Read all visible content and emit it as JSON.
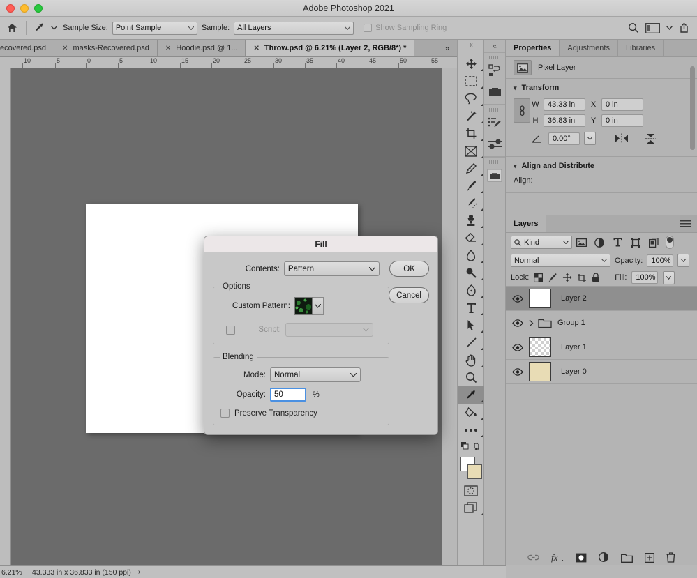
{
  "window": {
    "title": "Adobe Photoshop 2021",
    "traffic_lights": [
      "close",
      "minimize",
      "zoom"
    ]
  },
  "options_bar": {
    "home_icon": "home-icon",
    "tool_icon": "eyedropper-icon",
    "sample_size_label": "Sample Size:",
    "sample_size_value": "Point Sample",
    "sample_label": "Sample:",
    "sample_value": "All Layers",
    "show_sampling_ring_label": "Show Sampling Ring",
    "show_sampling_ring_checked": false,
    "right_icons": [
      "search-icon",
      "workspace-icon",
      "chevron-down-icon",
      "share-icon"
    ]
  },
  "tabs": [
    {
      "label": "ecovered.psd",
      "active": false,
      "closable": false
    },
    {
      "label": "masks-Recovered.psd",
      "active": false,
      "closable": true
    },
    {
      "label": "Hoodie.psd @ 1...",
      "active": false,
      "closable": true
    },
    {
      "label": "Throw.psd @ 6.21% (Layer 2, RGB/8*) *",
      "active": true,
      "closable": true
    }
  ],
  "tab_overflow": "»",
  "ruler": {
    "unit_marks": [
      "10",
      "5",
      "0",
      "5",
      "10",
      "15",
      "20",
      "25",
      "30",
      "35",
      "40",
      "45",
      "50",
      "55"
    ]
  },
  "toolbar": {
    "collapse_icon": "double-chevron-left-icon",
    "tools": [
      {
        "name": "move-tool",
        "selected": false
      },
      {
        "name": "rectangular-marquee-tool",
        "selected": false
      },
      {
        "name": "lasso-tool",
        "selected": false
      },
      {
        "name": "magic-wand-tool",
        "selected": false
      },
      {
        "name": "crop-tool",
        "selected": false
      },
      {
        "name": "frame-tool",
        "selected": false
      },
      {
        "name": "eyedropper-tool-top",
        "selected": false
      },
      {
        "name": "brush-tool",
        "selected": false
      },
      {
        "name": "healing-brush-tool",
        "selected": false
      },
      {
        "name": "clone-stamp-tool",
        "selected": false
      },
      {
        "name": "eraser-tool",
        "selected": false
      },
      {
        "name": "blur-tool",
        "selected": false
      },
      {
        "name": "dodge-tool",
        "selected": false
      },
      {
        "name": "pen-tool",
        "selected": false
      },
      {
        "name": "type-tool",
        "selected": false
      },
      {
        "name": "path-selection-tool",
        "selected": false
      },
      {
        "name": "line-shape-tool",
        "selected": false
      },
      {
        "name": "hand-tool",
        "selected": false
      },
      {
        "name": "zoom-tool",
        "selected": false
      },
      {
        "name": "eyedropper-tool",
        "selected": true
      },
      {
        "name": "paint-bucket-tool",
        "selected": false
      },
      {
        "name": "edit-toolbar-tool",
        "selected": false
      }
    ],
    "foreground_color": "#ffffff",
    "background_color": "#e8dcb5",
    "quickmask_icon": "quick-mask-icon",
    "screenmode_icon": "screen-mode-icon"
  },
  "dock_strip": {
    "collapse_icon": "double-chevron-left-icon",
    "buttons": [
      "history-icon",
      "swatches-icon",
      "brush-settings-icon",
      "adjust-sliders-icon",
      "libraries-folder-icon"
    ]
  },
  "properties_panel": {
    "tabs": [
      {
        "label": "Properties",
        "active": true
      },
      {
        "label": "Adjustments",
        "active": false
      },
      {
        "label": "Libraries",
        "active": false
      }
    ],
    "layer_type": "Pixel Layer",
    "layer_type_icon": "image-icon",
    "transform": {
      "section_title": "Transform",
      "w_label": "W",
      "w_value": "43.33 in",
      "h_label": "H",
      "h_value": "36.83 in",
      "x_label": "X",
      "x_value": "0 in",
      "y_label": "Y",
      "y_value": "0 in",
      "angle_value": "0.00°",
      "link_icon": "link-chain-icon",
      "angle_icon": "angle-icon",
      "flip_h_icon": "flip-horizontal-icon",
      "flip_v_icon": "flip-vertical-icon"
    },
    "align": {
      "section_title": "Align and Distribute",
      "align_label": "Align:"
    }
  },
  "layers_panel": {
    "tab_label": "Layers",
    "menu_icon": "panel-menu-icon",
    "filter": {
      "kind_label": "Kind",
      "search_icon": "search-icon",
      "icons": [
        "pixel-filter-icon",
        "adjustment-filter-icon",
        "type-filter-icon",
        "shape-filter-icon",
        "smart-object-filter-icon"
      ],
      "toggle_on": true
    },
    "blend_mode": "Normal",
    "opacity_label": "Opacity:",
    "opacity_value": "100%",
    "lock_label": "Lock:",
    "lock_icons": [
      "lock-transparency-icon",
      "lock-image-icon",
      "lock-position-icon",
      "lock-artboard-icon",
      "lock-all-icon"
    ],
    "fill_label": "Fill:",
    "fill_value": "100%",
    "layers": [
      {
        "name": "Layer 2",
        "thumb": "white",
        "visible": true,
        "selected": true,
        "type": "layer"
      },
      {
        "name": "Group 1",
        "thumb": "folder",
        "visible": true,
        "selected": false,
        "type": "group"
      },
      {
        "name": "Layer 1",
        "thumb": "checker",
        "visible": true,
        "selected": false,
        "type": "layer"
      },
      {
        "name": "Layer 0",
        "thumb": "beige",
        "visible": true,
        "selected": false,
        "type": "layer"
      }
    ],
    "bottom_icons": [
      "link-layers-icon",
      "layer-style-fx-icon",
      "layer-mask-icon",
      "adjustment-layer-icon",
      "new-group-icon",
      "new-layer-icon",
      "delete-layer-icon"
    ]
  },
  "status_bar": {
    "zoom": "6.21%",
    "doc_size": "43.333 in x 36.833 in (150 ppi)",
    "arrow": "›"
  },
  "fill_dialog": {
    "title": "Fill",
    "contents_label": "Contents:",
    "contents_value": "Pattern",
    "ok_label": "OK",
    "cancel_label": "Cancel",
    "options_legend": "Options",
    "custom_pattern_label": "Custom Pattern:",
    "script_label": "Script:",
    "script_enabled": false,
    "script_value": "",
    "blending_legend": "Blending",
    "mode_label": "Mode:",
    "mode_value": "Normal",
    "opacity_label": "Opacity:",
    "opacity_value": "50",
    "percent_label": "%",
    "preserve_transparency_label": "Preserve Transparency",
    "preserve_transparency_checked": false,
    "accent_color": "#4a90e2",
    "titlebar_color": "#ece7e8"
  }
}
